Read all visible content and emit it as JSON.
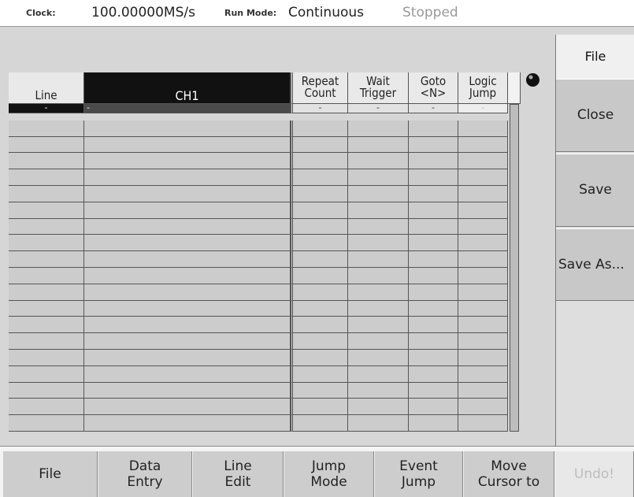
{
  "status": {
    "clock_label": "Clock:",
    "clock_value": "100.00000MS/s",
    "runmode_label": "Run Mode:",
    "runmode_value": "Continuous",
    "state": "Stopped"
  },
  "table": {
    "headers": {
      "line": "Line",
      "ch1": "CH1",
      "repeat_count": [
        "Repeat",
        "Count"
      ],
      "wait_trigger": [
        "Wait",
        "Trigger"
      ],
      "goto_n": [
        "Goto",
        "<N>"
      ],
      "logic_jump": [
        "Logic",
        "Jump"
      ]
    },
    "selected_row": {
      "line": "-",
      "ch1": "-",
      "repeat_count": "-",
      "wait_trigger": "-",
      "goto_n": "-",
      "logic_jump": "-"
    }
  },
  "side_menu": {
    "title": "File",
    "buttons": [
      "Close",
      "Save",
      "Save As..."
    ]
  },
  "bottom_menu": {
    "buttons": [
      [
        "File"
      ],
      [
        "Data",
        "Entry"
      ],
      [
        "Line",
        "Edit"
      ],
      [
        "Jump",
        "Mode"
      ],
      [
        "Event",
        "Jump"
      ],
      [
        "Move",
        "Cursor to"
      ],
      [
        "Undo!"
      ]
    ]
  }
}
